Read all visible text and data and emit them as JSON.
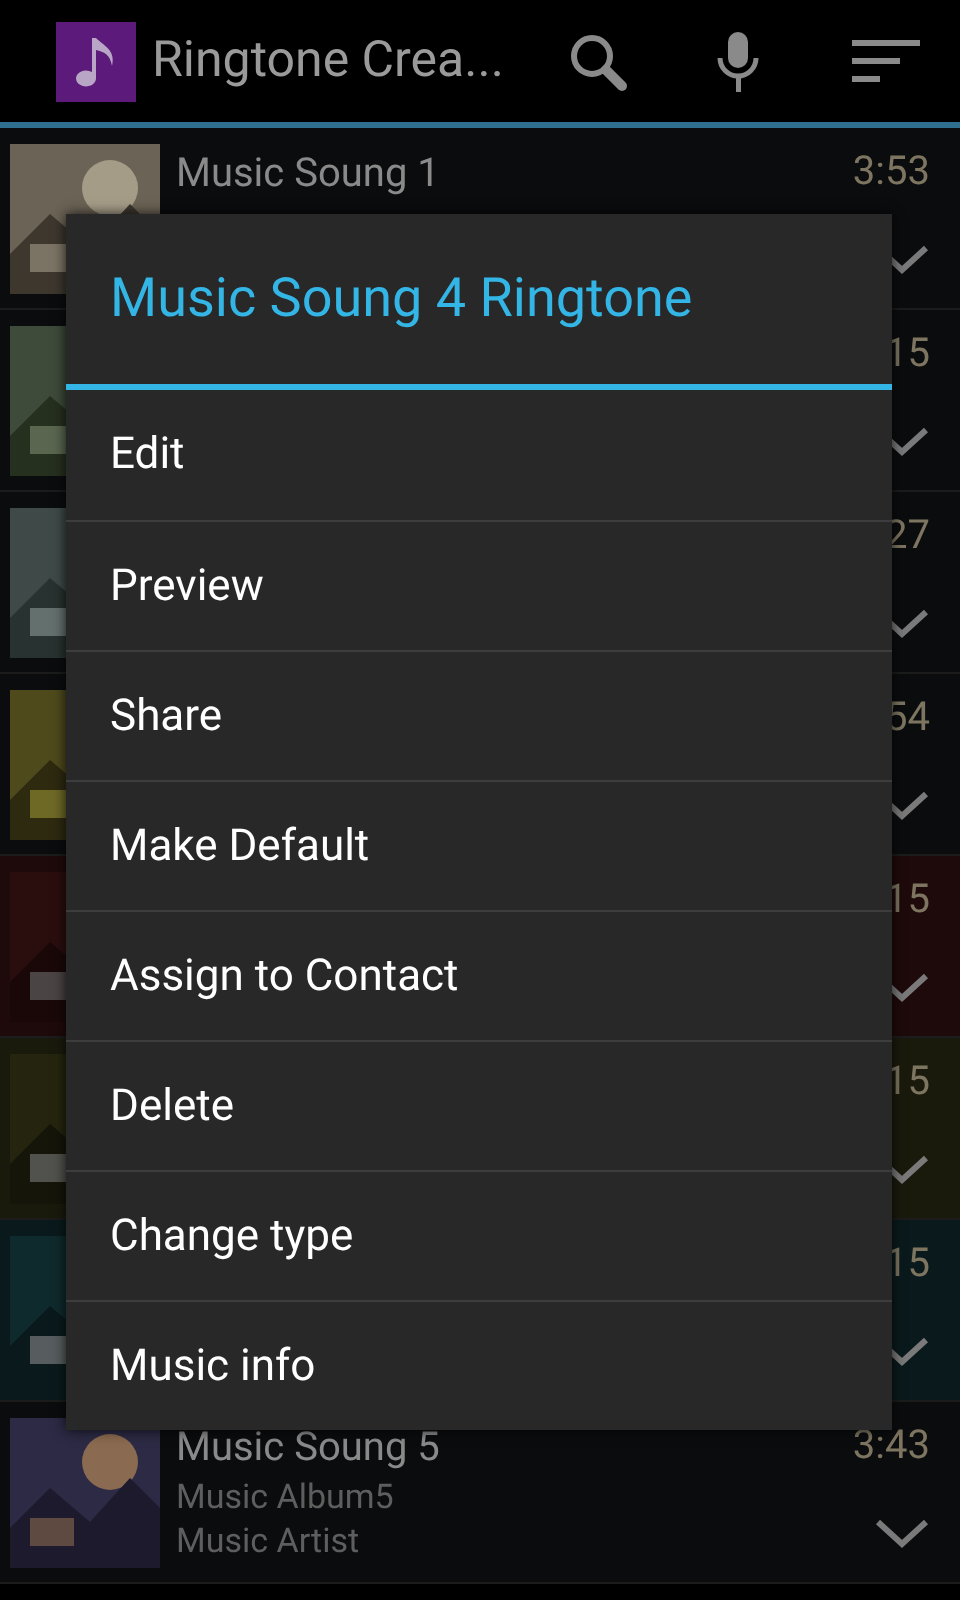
{
  "action_bar": {
    "title": "Ringtone Crea..."
  },
  "songs": [
    {
      "title": "Music Soung 1",
      "duration": "3:53",
      "color": "#0b0c0e"
    },
    {
      "duration": "15",
      "color": "#0b0c0e"
    },
    {
      "duration": "27",
      "color": "#0b0c0e"
    },
    {
      "duration": "54",
      "color": "#0b0c0e"
    },
    {
      "duration": "15",
      "color": "#1e0a0a"
    },
    {
      "duration": "15",
      "color": "#1a1a0c"
    },
    {
      "duration": "15",
      "color": "#0a1a1c"
    },
    {
      "title": "Music Soung 5",
      "album": "Music Album5",
      "artist": "Music Artist",
      "duration": "3:43",
      "color": "#0b0c0e"
    }
  ],
  "dialog": {
    "title": "Music Soung 4 Ringtone",
    "items": [
      "Edit",
      "Preview",
      "Share",
      "Make Default",
      "Assign to Contact",
      "Delete",
      "Change type",
      "Music info"
    ]
  }
}
